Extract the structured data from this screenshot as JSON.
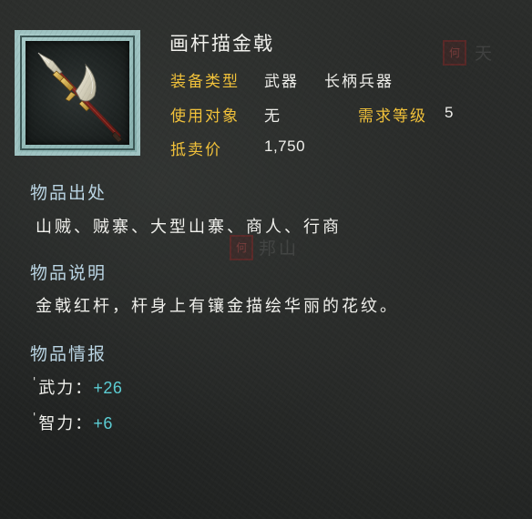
{
  "item": {
    "name": "画杆描金戟",
    "type_label": "装备类型",
    "type_value_1": "武器",
    "type_value_2": "长柄兵器",
    "target_label": "使用对象",
    "target_value": "无",
    "level_label": "需求等级",
    "level_value": "5",
    "price_label": "抵卖价",
    "price_value": "1,750",
    "icon": "halberd-icon"
  },
  "sections": {
    "source": {
      "title": "物品出处",
      "text": "山贼、贼寨、大型山寨、商人、行商"
    },
    "description": {
      "title": "物品说明",
      "text": "金戟红杆，杆身上有镶金描绘华丽的花纹。"
    },
    "stats": {
      "title": "物品情报",
      "items": [
        {
          "label": "武力：",
          "value": "+26"
        },
        {
          "label": "智力：",
          "value": "+6"
        }
      ]
    }
  },
  "colors": {
    "label_gold": "#f2c23a",
    "section_blue": "#bcd7e6",
    "stat_cyan": "#5ccfd6",
    "frame_teal": "#9fc3c2"
  }
}
